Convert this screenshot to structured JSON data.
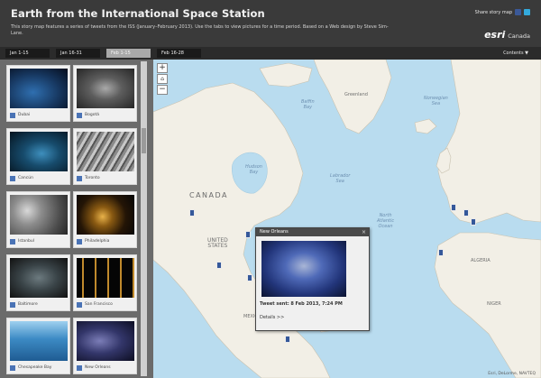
{
  "header": {
    "title": "Earth from the International Space Station",
    "description": "This story map features a series of tweets from the ISS (January–February 2013). Use the tabs to view pictures for a time period. Based on a Web design by Steve Sim-Lane.",
    "share_label": "Share story map",
    "logo_text": "esri",
    "logo_suffix": "Canada"
  },
  "tabs": [
    {
      "label": "Jan 1-15"
    },
    {
      "label": "Jan 16-31"
    },
    {
      "label": "Feb 1-15"
    },
    {
      "label": "Feb 16-28"
    }
  ],
  "contents_label": "Contents ▼",
  "sidebar": {
    "items": [
      {
        "label": "Dubai"
      },
      {
        "label": "Bogotá"
      },
      {
        "label": "Cancún"
      },
      {
        "label": "Toronto"
      },
      {
        "label": "Istanbul"
      },
      {
        "label": "Philadelphia"
      },
      {
        "label": "Baltimore"
      },
      {
        "label": "San Francisco"
      },
      {
        "label": "Chesapeake Bay"
      },
      {
        "label": "New Orleans"
      }
    ]
  },
  "map": {
    "labels": {
      "canada": "CANADA",
      "united_states": "UNITED\nSTATES",
      "greenland": "Greenland",
      "hudson_bay": "Hudson\nBay",
      "labrador_sea": "Labrador\nSea",
      "baffin_bay": "Baffin\nBay",
      "norwegian_sea": "Norwegian\nSea",
      "north_atlantic": "North\nAtlantic\nOcean",
      "mexico": "MEXICO",
      "algeria": "ALGERIA",
      "niger": "NIGER"
    },
    "attribution": "Esri, DeLorme, NAVTEQ"
  },
  "popup": {
    "title": "New Orleans",
    "close": "×",
    "tweet_label": "Tweet sent:",
    "tweet_date": "8 Feb 2013, 7:24 PM",
    "details_label": "Details >>"
  },
  "colors": {
    "header_bg": "#3a3a3a",
    "water": "#b9dcef",
    "land": "#f2efe6",
    "accent": "#35589a"
  },
  "icons": {
    "facebook": "facebook-icon",
    "twitter": "twitter-icon",
    "zoom_in": "+",
    "zoom_out": "−",
    "home": "⌂"
  }
}
